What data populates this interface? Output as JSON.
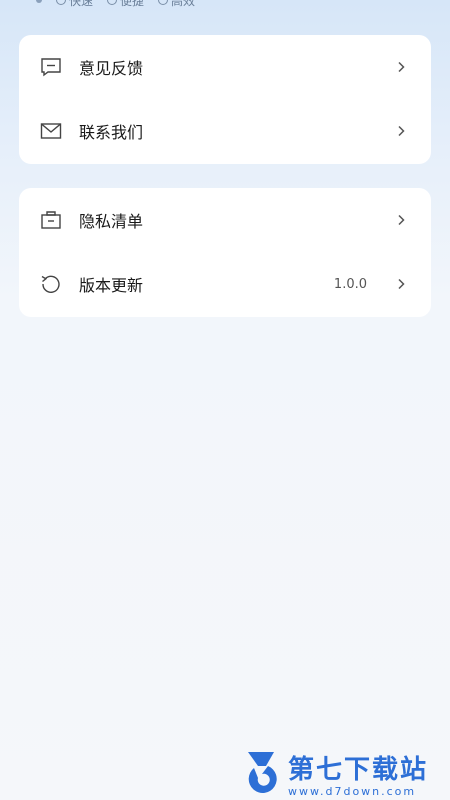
{
  "top_tags": [
    "快速",
    "便捷",
    "高效"
  ],
  "menu_group_1": [
    {
      "label": "意见反馈",
      "icon": "feedback-icon"
    },
    {
      "label": "联系我们",
      "icon": "mail-icon"
    }
  ],
  "menu_group_2": [
    {
      "label": "隐私清单",
      "icon": "privacy-list-icon"
    },
    {
      "label": "版本更新",
      "icon": "refresh-icon",
      "value": "1.0.0"
    }
  ],
  "watermark": {
    "title": "第七下载站",
    "url": "www.d7down.com"
  },
  "colors": {
    "accent": "#2d6fd6",
    "card": "#ffffff",
    "background": "#f5f7fa"
  }
}
